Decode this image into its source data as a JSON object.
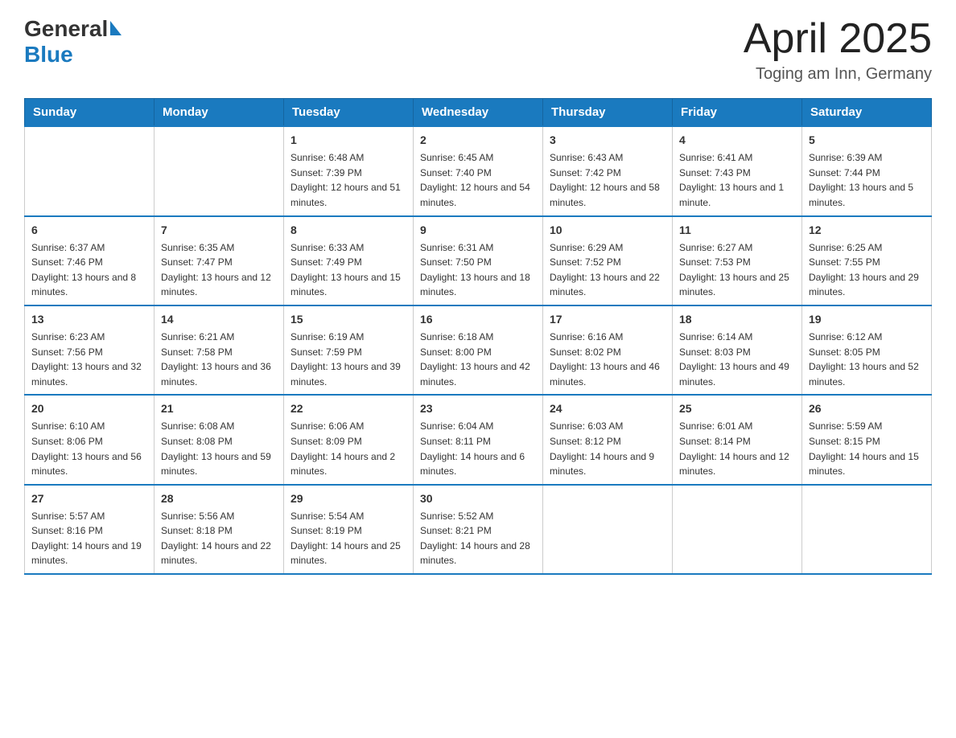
{
  "header": {
    "title": "April 2025",
    "location": "Toging am Inn, Germany",
    "logo_general": "General",
    "logo_blue": "Blue"
  },
  "days_of_week": [
    "Sunday",
    "Monday",
    "Tuesday",
    "Wednesday",
    "Thursday",
    "Friday",
    "Saturday"
  ],
  "weeks": [
    [
      {
        "day": "",
        "sunrise": "",
        "sunset": "",
        "daylight": ""
      },
      {
        "day": "",
        "sunrise": "",
        "sunset": "",
        "daylight": ""
      },
      {
        "day": "1",
        "sunrise": "Sunrise: 6:48 AM",
        "sunset": "Sunset: 7:39 PM",
        "daylight": "Daylight: 12 hours and 51 minutes."
      },
      {
        "day": "2",
        "sunrise": "Sunrise: 6:45 AM",
        "sunset": "Sunset: 7:40 PM",
        "daylight": "Daylight: 12 hours and 54 minutes."
      },
      {
        "day": "3",
        "sunrise": "Sunrise: 6:43 AM",
        "sunset": "Sunset: 7:42 PM",
        "daylight": "Daylight: 12 hours and 58 minutes."
      },
      {
        "day": "4",
        "sunrise": "Sunrise: 6:41 AM",
        "sunset": "Sunset: 7:43 PM",
        "daylight": "Daylight: 13 hours and 1 minute."
      },
      {
        "day": "5",
        "sunrise": "Sunrise: 6:39 AM",
        "sunset": "Sunset: 7:44 PM",
        "daylight": "Daylight: 13 hours and 5 minutes."
      }
    ],
    [
      {
        "day": "6",
        "sunrise": "Sunrise: 6:37 AM",
        "sunset": "Sunset: 7:46 PM",
        "daylight": "Daylight: 13 hours and 8 minutes."
      },
      {
        "day": "7",
        "sunrise": "Sunrise: 6:35 AM",
        "sunset": "Sunset: 7:47 PM",
        "daylight": "Daylight: 13 hours and 12 minutes."
      },
      {
        "day": "8",
        "sunrise": "Sunrise: 6:33 AM",
        "sunset": "Sunset: 7:49 PM",
        "daylight": "Daylight: 13 hours and 15 minutes."
      },
      {
        "day": "9",
        "sunrise": "Sunrise: 6:31 AM",
        "sunset": "Sunset: 7:50 PM",
        "daylight": "Daylight: 13 hours and 18 minutes."
      },
      {
        "day": "10",
        "sunrise": "Sunrise: 6:29 AM",
        "sunset": "Sunset: 7:52 PM",
        "daylight": "Daylight: 13 hours and 22 minutes."
      },
      {
        "day": "11",
        "sunrise": "Sunrise: 6:27 AM",
        "sunset": "Sunset: 7:53 PM",
        "daylight": "Daylight: 13 hours and 25 minutes."
      },
      {
        "day": "12",
        "sunrise": "Sunrise: 6:25 AM",
        "sunset": "Sunset: 7:55 PM",
        "daylight": "Daylight: 13 hours and 29 minutes."
      }
    ],
    [
      {
        "day": "13",
        "sunrise": "Sunrise: 6:23 AM",
        "sunset": "Sunset: 7:56 PM",
        "daylight": "Daylight: 13 hours and 32 minutes."
      },
      {
        "day": "14",
        "sunrise": "Sunrise: 6:21 AM",
        "sunset": "Sunset: 7:58 PM",
        "daylight": "Daylight: 13 hours and 36 minutes."
      },
      {
        "day": "15",
        "sunrise": "Sunrise: 6:19 AM",
        "sunset": "Sunset: 7:59 PM",
        "daylight": "Daylight: 13 hours and 39 minutes."
      },
      {
        "day": "16",
        "sunrise": "Sunrise: 6:18 AM",
        "sunset": "Sunset: 8:00 PM",
        "daylight": "Daylight: 13 hours and 42 minutes."
      },
      {
        "day": "17",
        "sunrise": "Sunrise: 6:16 AM",
        "sunset": "Sunset: 8:02 PM",
        "daylight": "Daylight: 13 hours and 46 minutes."
      },
      {
        "day": "18",
        "sunrise": "Sunrise: 6:14 AM",
        "sunset": "Sunset: 8:03 PM",
        "daylight": "Daylight: 13 hours and 49 minutes."
      },
      {
        "day": "19",
        "sunrise": "Sunrise: 6:12 AM",
        "sunset": "Sunset: 8:05 PM",
        "daylight": "Daylight: 13 hours and 52 minutes."
      }
    ],
    [
      {
        "day": "20",
        "sunrise": "Sunrise: 6:10 AM",
        "sunset": "Sunset: 8:06 PM",
        "daylight": "Daylight: 13 hours and 56 minutes."
      },
      {
        "day": "21",
        "sunrise": "Sunrise: 6:08 AM",
        "sunset": "Sunset: 8:08 PM",
        "daylight": "Daylight: 13 hours and 59 minutes."
      },
      {
        "day": "22",
        "sunrise": "Sunrise: 6:06 AM",
        "sunset": "Sunset: 8:09 PM",
        "daylight": "Daylight: 14 hours and 2 minutes."
      },
      {
        "day": "23",
        "sunrise": "Sunrise: 6:04 AM",
        "sunset": "Sunset: 8:11 PM",
        "daylight": "Daylight: 14 hours and 6 minutes."
      },
      {
        "day": "24",
        "sunrise": "Sunrise: 6:03 AM",
        "sunset": "Sunset: 8:12 PM",
        "daylight": "Daylight: 14 hours and 9 minutes."
      },
      {
        "day": "25",
        "sunrise": "Sunrise: 6:01 AM",
        "sunset": "Sunset: 8:14 PM",
        "daylight": "Daylight: 14 hours and 12 minutes."
      },
      {
        "day": "26",
        "sunrise": "Sunrise: 5:59 AM",
        "sunset": "Sunset: 8:15 PM",
        "daylight": "Daylight: 14 hours and 15 minutes."
      }
    ],
    [
      {
        "day": "27",
        "sunrise": "Sunrise: 5:57 AM",
        "sunset": "Sunset: 8:16 PM",
        "daylight": "Daylight: 14 hours and 19 minutes."
      },
      {
        "day": "28",
        "sunrise": "Sunrise: 5:56 AM",
        "sunset": "Sunset: 8:18 PM",
        "daylight": "Daylight: 14 hours and 22 minutes."
      },
      {
        "day": "29",
        "sunrise": "Sunrise: 5:54 AM",
        "sunset": "Sunset: 8:19 PM",
        "daylight": "Daylight: 14 hours and 25 minutes."
      },
      {
        "day": "30",
        "sunrise": "Sunrise: 5:52 AM",
        "sunset": "Sunset: 8:21 PM",
        "daylight": "Daylight: 14 hours and 28 minutes."
      },
      {
        "day": "",
        "sunrise": "",
        "sunset": "",
        "daylight": ""
      },
      {
        "day": "",
        "sunrise": "",
        "sunset": "",
        "daylight": ""
      },
      {
        "day": "",
        "sunrise": "",
        "sunset": "",
        "daylight": ""
      }
    ]
  ]
}
